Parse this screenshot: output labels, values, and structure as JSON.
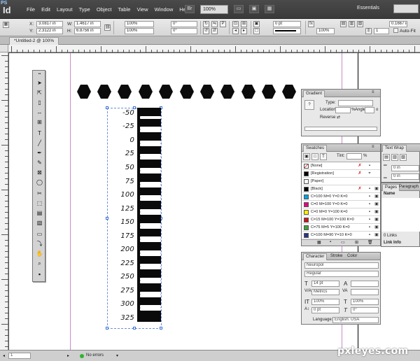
{
  "app": {
    "badge": "PS",
    "logo": "Id"
  },
  "menu": [
    "File",
    "Edit",
    "Layout",
    "Type",
    "Object",
    "Table",
    "View",
    "Window",
    "Help"
  ],
  "bridge_label": "Br",
  "zoom": "100%",
  "workspace": "Essentials",
  "control": {
    "x_label": "X:",
    "x_value": "3.0817 in",
    "y_label": "Y:",
    "y_value": "2.3122 in",
    "w_label": "W:",
    "w_value": "1.4617 in",
    "h_label": "H:",
    "h_value": "6.8756 in",
    "scale_x": "100%",
    "scale_y": "100%",
    "rotate": "0°",
    "shear": "0°",
    "stroke_weight": "0 pt",
    "opacity": "100%",
    "offset": "0.1667 in",
    "columns": "1",
    "autofit_label": "Auto-Fit"
  },
  "document_tab": "*Untitled-2 @ 100%",
  "ruler_labels": [
    "-50",
    "-25",
    "0",
    "25",
    "50",
    "75",
    "100",
    "125",
    "150",
    "175",
    "200",
    "225",
    "250",
    "275",
    "300",
    "325"
  ],
  "gradient_panel": {
    "title": "Gradient",
    "type_label": "Type:",
    "location_label": "Location:",
    "location_unit": "%",
    "angle_label": "Angle:",
    "angle_unit": "o",
    "reverse_label": "Reverse"
  },
  "swatches_panel": {
    "title": "Swatches",
    "tint_label": "Tint:",
    "tint_unit": "%",
    "rows": [
      {
        "name": "[None]",
        "color": "#ffffff"
      },
      {
        "name": "[Registration]",
        "color": "#000000"
      },
      {
        "name": "[Paper]",
        "color": "#ffffff"
      },
      {
        "name": "[Black]",
        "color": "#000000"
      },
      {
        "name": "C=100 M=0 Y=0 K=0",
        "color": "#00a0e3"
      },
      {
        "name": "C=0 M=100 Y=0 K=0",
        "color": "#e4007f"
      },
      {
        "name": "C=0 M=0 Y=100 K=0",
        "color": "#fff000"
      },
      {
        "name": "C=15 M=100 Y=100 K=0",
        "color": "#c5161d"
      },
      {
        "name": "C=75 M=5 Y=100 K=0",
        "color": "#3ea33a"
      },
      {
        "name": "C=100 M=90 Y=10 K=0",
        "color": "#27357f"
      }
    ]
  },
  "textwrap_panel": {
    "title": "Text Wrap",
    "offset_top": "0 in",
    "offset_bottom": "0 in"
  },
  "pages_panel": {
    "tab_pages": "Pages",
    "tab_paragraph": "Paragraph",
    "name_header": "Name",
    "links_count": "0 Links",
    "link_info": "Link Info"
  },
  "character_panel": {
    "tab_character": "Character",
    "tab_stroke": "Stroke",
    "tab_color": "Color",
    "font_family": "Neuropol",
    "font_style": "Regular",
    "size": "14 pt",
    "kerning": "Metrics",
    "vscale": "100%",
    "hscale": "100%",
    "baseline": "0 pt",
    "skew": "0°",
    "language_label": "Language:",
    "language": "English: USA"
  },
  "status": {
    "page": "1",
    "errors": "No errors"
  },
  "watermark": "pxleyes.com"
}
